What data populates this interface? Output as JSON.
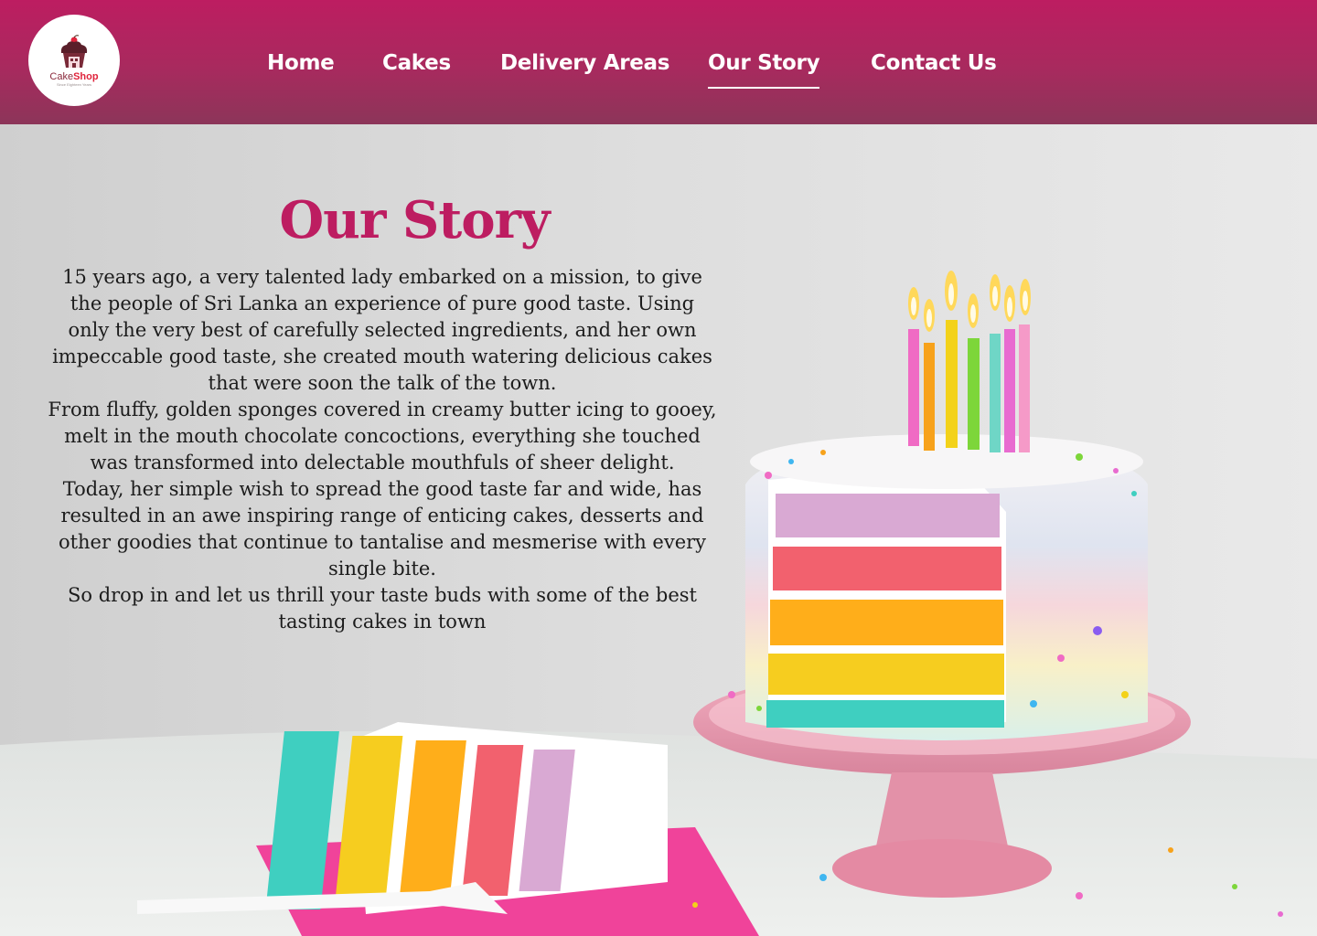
{
  "brand": {
    "logo_word_1": "Cake",
    "logo_word_2": "Shop",
    "logo_tagline": "Since Eighteen Years",
    "primary_color": "#bd1d61",
    "header_gradient_end": "#8c3559"
  },
  "nav": {
    "items": [
      {
        "label": "Home",
        "active": false
      },
      {
        "label": "Cakes",
        "active": false
      },
      {
        "label": "Delivery Areas",
        "active": false
      },
      {
        "label": "Our Story",
        "active": true
      },
      {
        "label": "Contact Us",
        "active": false
      }
    ]
  },
  "story": {
    "title": "Our Story",
    "paragraphs": [
      "15 years ago, a very talented lady embarked on a mission, to give the people of Sri Lanka an experience of pure good taste. Using only the very best of carefully selected ingredients, and her own impeccable good taste, she created mouth watering delicious cakes that were soon the talk of the town.",
      "From fluffy, golden sponges covered in creamy butter icing to gooey, melt in the mouth chocolate concoctions, everything she touched was transformed into delectable mouthfuls of sheer delight.",
      "Today, her simple wish to spread the good taste far and wide, has resulted in an awe inspiring range of enticing cakes, desserts and other goodies that continue to tantalise and mesmerise with every single bite.",
      "So drop in and let us thrill your taste buds with some of the best tasting cakes in town"
    ]
  },
  "hero": {
    "image": "rainbow-layer-birthday-cake-photo",
    "candle_colors": [
      "#f06bc4",
      "#f7a21b",
      "#f3d21a",
      "#7dd63a",
      "#6fd6c6",
      "#e86bd0",
      "#f59ac8"
    ]
  }
}
